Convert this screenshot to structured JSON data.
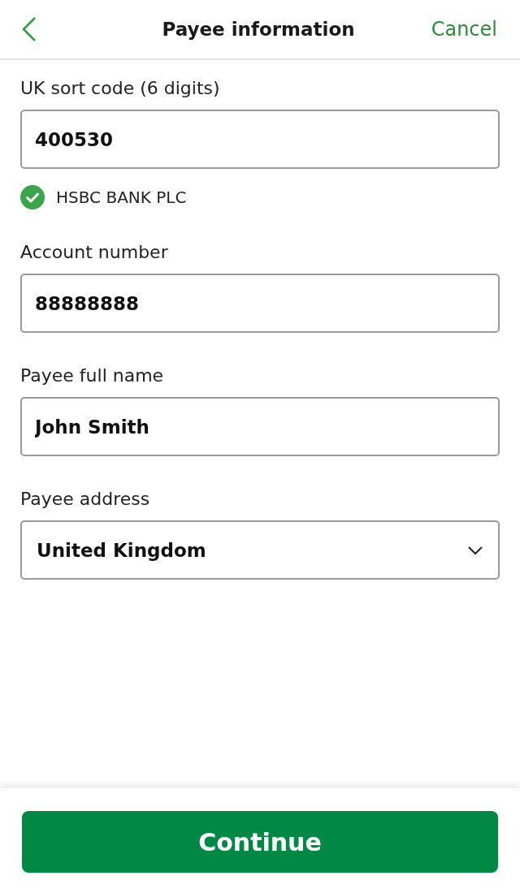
{
  "header": {
    "title": "Payee information",
    "cancel": "Cancel"
  },
  "fields": [
    {
      "kind": "text",
      "label": "UK sort code (6 digits)",
      "value": "400530",
      "verified": true,
      "note": "HSBC BANK PLC"
    },
    {
      "kind": "text",
      "label": "Account number",
      "value": "88888888"
    },
    {
      "kind": "text",
      "label": "Payee full name",
      "value": "John Smith"
    },
    {
      "kind": "select",
      "label": "Payee address",
      "value": "United Kingdom"
    }
  ],
  "button": "Continue"
}
